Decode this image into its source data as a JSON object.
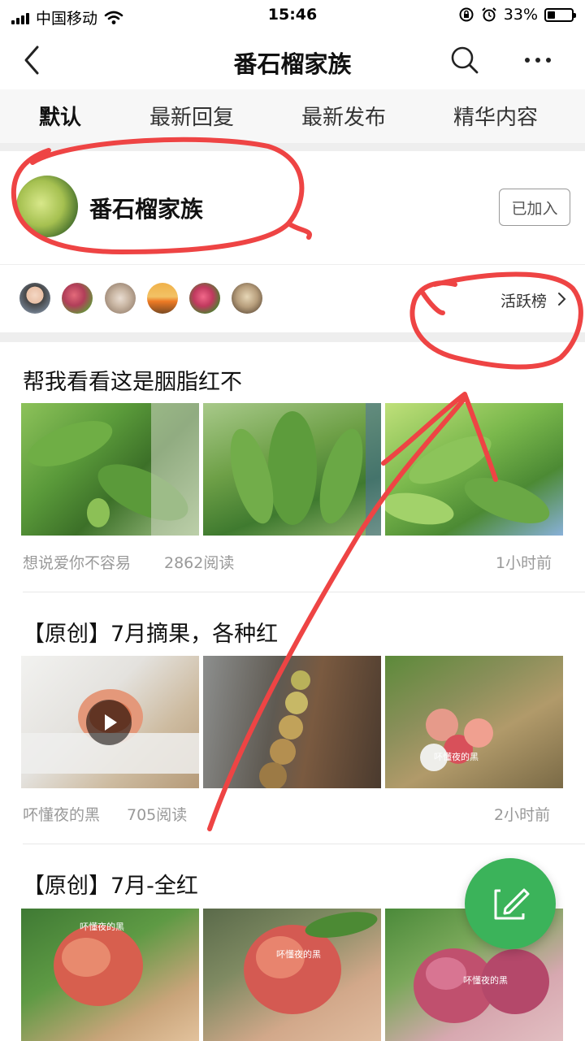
{
  "status_bar": {
    "carrier": "中国移动",
    "time": "15:46",
    "battery": "33%"
  },
  "nav": {
    "title": "番石榴家族",
    "back_icon": "chevron-left-icon",
    "search_icon": "search-icon",
    "more_icon": "more-icon"
  },
  "tabs": [
    "默认",
    "最新回复",
    "最新发布",
    "精华内容"
  ],
  "group": {
    "name": "番石榴家族",
    "join_status": "已加入"
  },
  "members": {
    "rank_label": "活跃榜"
  },
  "posts": [
    {
      "title": "帮我看看这是胭脂红不",
      "author": "想说爱你不容易",
      "reads": "2862阅读",
      "time": "1小时前"
    },
    {
      "title": "【原创】7月摘果，各种红",
      "author": "吥懂夜的黑",
      "reads": "705阅读",
      "time": "2小时前"
    },
    {
      "title": "【原创】7月-全红"
    }
  ],
  "watermark": "吥懂夜的黑",
  "fab": {
    "icon": "edit-icon"
  },
  "colors": {
    "accent": "#3bb35a",
    "annotation": "#ee4444"
  }
}
